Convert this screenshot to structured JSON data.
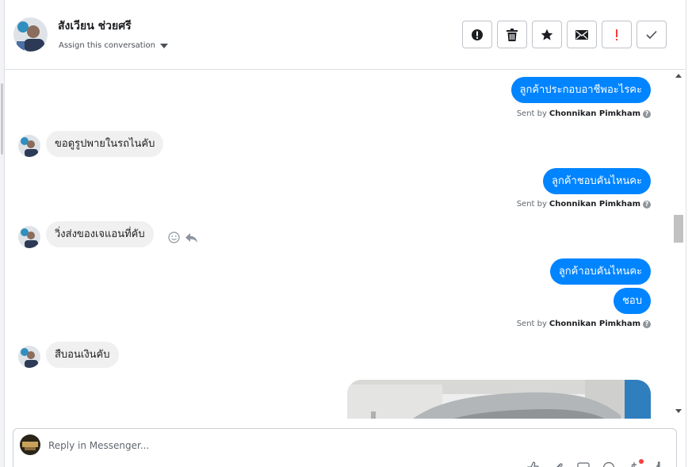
{
  "header": {
    "contact_name": "สังเวียน ช่วยศรี",
    "assign_label": "Assign this conversation"
  },
  "actions": [
    {
      "name": "mark-spam-button",
      "icon": "alert-circle-icon"
    },
    {
      "name": "delete-button",
      "icon": "trash-icon"
    },
    {
      "name": "star-button",
      "icon": "star-icon"
    },
    {
      "name": "mark-unread-button",
      "icon": "envelope-icon"
    },
    {
      "name": "follow-up-button",
      "icon": "exclamation-icon",
      "color": "#fa3e3e"
    },
    {
      "name": "mark-done-button",
      "icon": "checkmark-icon"
    }
  ],
  "messages": [
    {
      "dir": "out",
      "text": "ลูกค้าประกอบอาชีพอะไรคะ"
    },
    {
      "type": "sentby",
      "prefix": "Sent by",
      "name": "Chonnikan Pimkham"
    },
    {
      "dir": "in",
      "text": "ขอดูรูปพายในรถไนคับ"
    },
    {
      "dir": "out",
      "text": "ลูกค้าชอบคันไหนคะ"
    },
    {
      "type": "sentby",
      "prefix": "Sent by",
      "name": "Chonnikan Pimkham"
    },
    {
      "dir": "in",
      "text": "วิ่งส่งของเจแอนที่คับ"
    },
    {
      "dir": "out",
      "text": "ลูกค้าอบคันไหนคะ"
    },
    {
      "dir": "out",
      "text": "ชอบ"
    },
    {
      "type": "sentby",
      "prefix": "Sent by",
      "name": "Chonnikan Pimkham"
    },
    {
      "dir": "in",
      "text": "สืบอนเงินคับ"
    }
  ],
  "composer": {
    "placeholder": "Reply in Messenger..."
  },
  "colors": {
    "accent": "#0084ff",
    "incoming_bubble": "#f1f0f0",
    "alert": "#fa3e3e"
  }
}
